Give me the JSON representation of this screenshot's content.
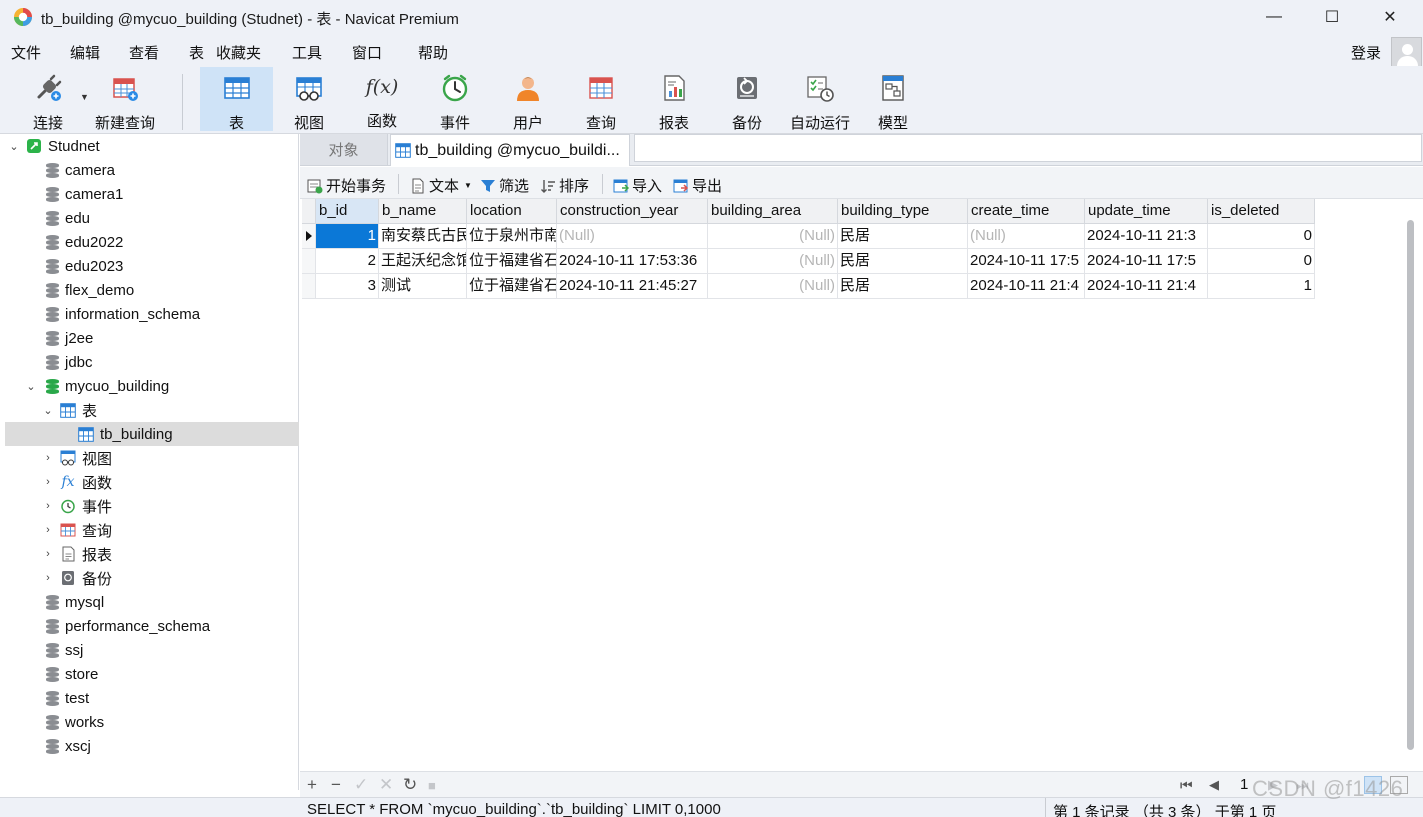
{
  "window": {
    "title": "tb_building @mycuo_building (Studnet) - 表 - Navicat Premium",
    "minimize_glyph": "—",
    "maximize_glyph": "☐",
    "close_glyph": "✕"
  },
  "menu": [
    "文件",
    "编辑",
    "查看",
    "表",
    "收藏夹",
    "工具",
    "窗口",
    "帮助"
  ],
  "login_label": "登录",
  "toolbar": {
    "tools": [
      {
        "label": "连接",
        "icon": "plug-icon"
      },
      {
        "label": "新建查询",
        "icon": "new-query-icon"
      },
      {
        "label": "表",
        "icon": "table-icon",
        "active": true
      },
      {
        "label": "视图",
        "icon": "view-icon"
      },
      {
        "label": "函数",
        "icon": "function-icon"
      },
      {
        "label": "事件",
        "icon": "clock-icon"
      },
      {
        "label": "用户",
        "icon": "user-icon"
      },
      {
        "label": "查询",
        "icon": "query-icon"
      },
      {
        "label": "报表",
        "icon": "report-icon"
      },
      {
        "label": "备份",
        "icon": "backup-icon"
      },
      {
        "label": "自动运行",
        "icon": "automation-icon"
      },
      {
        "label": "模型",
        "icon": "model-icon"
      }
    ],
    "function_glyph": "f(x)"
  },
  "sidebar": {
    "connection": "Studnet",
    "databases_top": [
      "camera",
      "camera1",
      "edu",
      "edu2022",
      "edu2023",
      "flex_demo",
      "information_schema",
      "j2ee",
      "jdbc"
    ],
    "open_db": "mycuo_building",
    "tables_group": "表",
    "selected_table": "tb_building",
    "groups": [
      "视图",
      "函数",
      "事件",
      "查询",
      "报表",
      "备份"
    ],
    "databases_bottom": [
      "mysql",
      "performance_schema",
      "ssj",
      "store",
      "test",
      "works",
      "xscj"
    ],
    "function_glyph": "fx"
  },
  "tabs": {
    "objects": "对象",
    "active": "tb_building @mycuo_buildi..."
  },
  "subtoolbar": {
    "begin_tx": "开始事务",
    "text": "文本",
    "filter": "筛选",
    "sort": "排序",
    "import": "导入",
    "export": "导出"
  },
  "grid": {
    "columns": [
      "b_id",
      "b_name",
      "location",
      "construction_year",
      "building_area",
      "building_type",
      "create_time",
      "update_time",
      "is_deleted"
    ],
    "rows": [
      [
        "1",
        "南安蔡氏古民",
        "位于泉州市南",
        "(Null)",
        "(Null)",
        "民居",
        "(Null)",
        "2024-10-11 21:3",
        "0"
      ],
      [
        "2",
        "王起沃纪念馆",
        "位于福建省石",
        "2024-10-11 17:53:36",
        "(Null)",
        "民居",
        "2024-10-11 17:5",
        "2024-10-11 17:5",
        "0"
      ],
      [
        "3",
        "测试",
        "位于福建省石",
        "2024-10-11 21:45:27",
        "(Null)",
        "民居",
        "2024-10-11 21:4",
        "2024-10-11 21:4",
        "1"
      ]
    ]
  },
  "gridfoot": {
    "add": "+",
    "remove": "−",
    "apply": "✓",
    "discard": "✕",
    "refresh": "↻",
    "stop": "■",
    "first": "⏮",
    "prev": "◀",
    "page": "1",
    "next": "▶",
    "last": "⏭"
  },
  "status": {
    "sql": "SELECT * FROM `mycuo_building`.`tb_building` LIMIT 0,1000",
    "records": "第 1 条记录 （共 3 条） 于第 1 页"
  },
  "watermark": "CSDN @f1426"
}
